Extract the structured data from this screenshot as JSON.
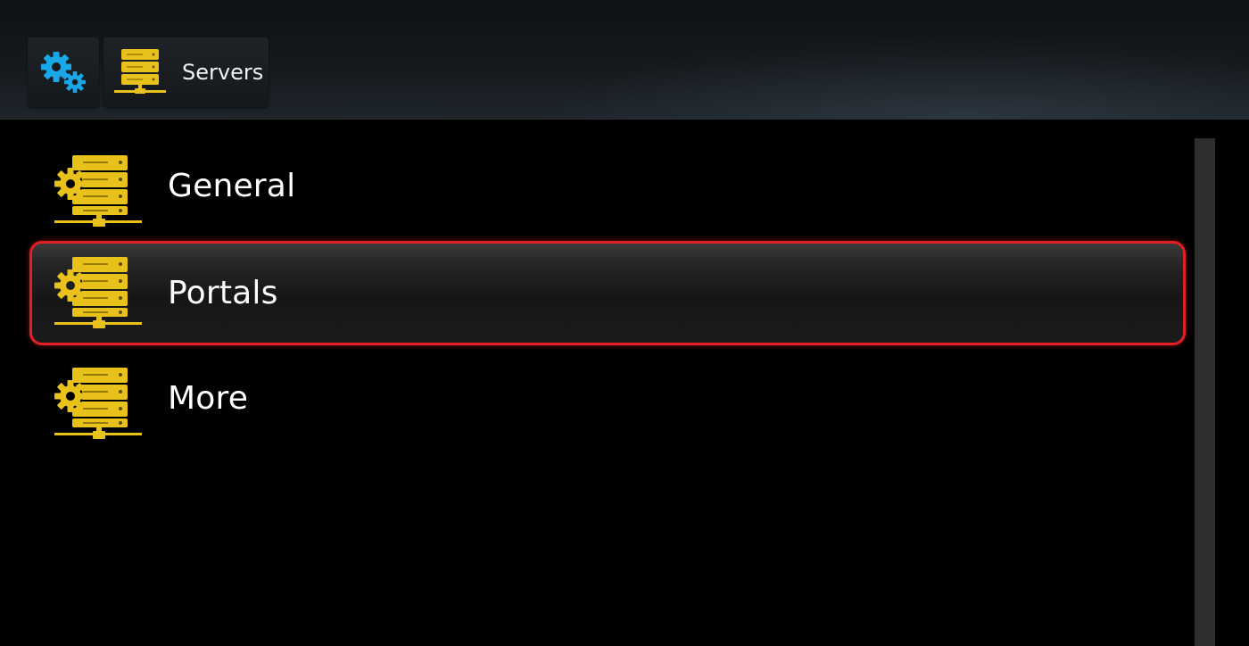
{
  "breadcrumb": {
    "settings_icon": "gears-icon",
    "current_label": "Servers",
    "current_icon": "server-icon"
  },
  "menu": {
    "items": [
      {
        "label": "General",
        "icon": "server-settings-icon",
        "selected": false
      },
      {
        "label": "Portals",
        "icon": "server-settings-icon",
        "selected": true
      },
      {
        "label": "More",
        "icon": "server-settings-icon",
        "selected": false
      }
    ]
  },
  "colors": {
    "accent_blue": "#1aa7e8",
    "icon_yellow": "#e8c21a",
    "selection_border": "#e11f25",
    "background": "#000000"
  }
}
